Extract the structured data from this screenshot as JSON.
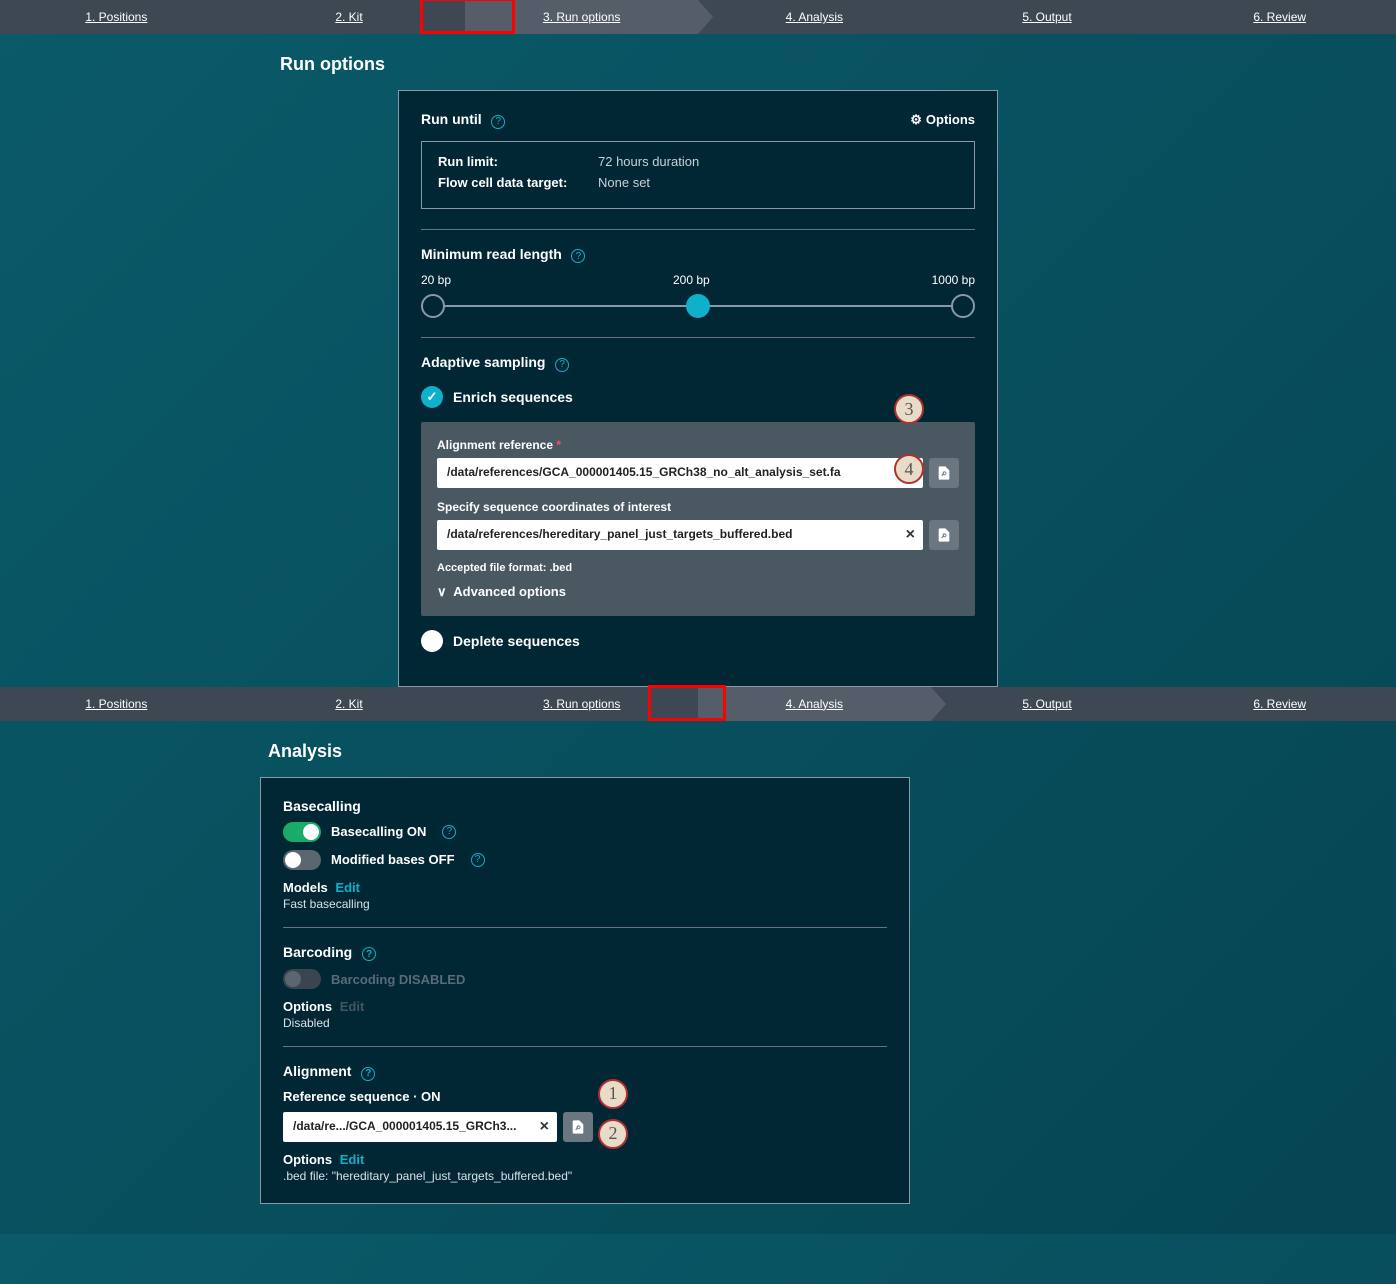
{
  "stepper": {
    "steps": [
      "1. Positions",
      "2. Kit",
      "3. Run options",
      "4. Analysis",
      "5. Output",
      "6. Review"
    ]
  },
  "runOptions": {
    "title": "Run options",
    "runUntil": {
      "label": "Run until",
      "optionsBtn": "Options",
      "runLimitKey": "Run limit:",
      "runLimitVal": "72 hours duration",
      "flowCellKey": "Flow cell data target:",
      "flowCellVal": "None set"
    },
    "minRead": {
      "label": "Minimum read length",
      "low": "20 bp",
      "mid": "200 bp",
      "high": "1000 bp"
    },
    "adaptive": {
      "label": "Adaptive sampling",
      "enrich": "Enrich sequences",
      "deplete": "Deplete sequences",
      "alignmentRef": "Alignment reference",
      "alignmentRefVal": "/data/references/GCA_000001405.15_GRCh38_no_alt_analysis_set.fa",
      "coordsLabel": "Specify sequence coordinates of interest",
      "coordsVal": "/data/references/hereditary_panel_just_targets_buffered.bed",
      "acceptedFormat": "Accepted file format: .bed",
      "advanced": "Advanced options"
    }
  },
  "analysis": {
    "title": "Analysis",
    "basecalling": {
      "heading": "Basecalling",
      "onLabel": "Basecalling ON",
      "modOffLabel": "Modified bases OFF",
      "modelsLabel": "Models",
      "edit": "Edit",
      "modelsVal": "Fast basecalling"
    },
    "barcoding": {
      "heading": "Barcoding",
      "disabledLabel": "Barcoding DISABLED",
      "optionsLabel": "Options",
      "edit": "Edit",
      "optionsVal": "Disabled"
    },
    "alignment": {
      "heading": "Alignment",
      "refLabel": "Reference sequence · ON",
      "refVal": "/data/re.../GCA_000001405.15_GRCh3...",
      "optionsLabel": "Options",
      "edit": "Edit",
      "bedFile": ".bed file: \"hereditary_panel_just_targets_buffered.bed\""
    }
  },
  "annotations": {
    "n1": "1",
    "n2": "2",
    "n3": "3",
    "n4": "4"
  }
}
